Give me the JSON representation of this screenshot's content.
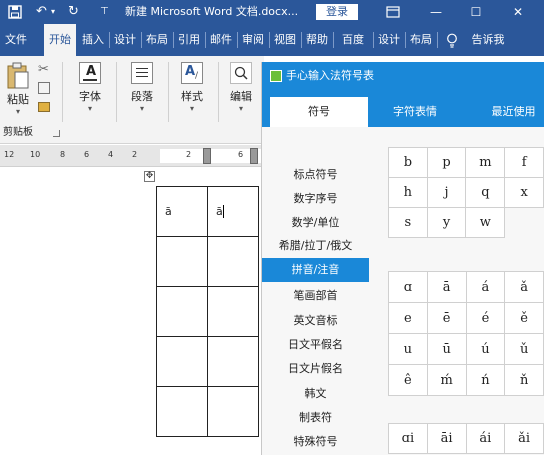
{
  "titlebar": {
    "save_icon": "save-icon",
    "undo_glyph": "↶",
    "redo_glyph": "↻",
    "customize_glyph": "⊤",
    "title": "新建 Microsoft Word 文档.docx...",
    "login": "登录",
    "ribbon_display_icon": "ribbon-display-icon",
    "window_buttons": [
      "—",
      "☐",
      "✕"
    ]
  },
  "ribbon_tabs": [
    "文件",
    "开始",
    "插入",
    "设计",
    "布局",
    "引用",
    "邮件",
    "审阅",
    "视图",
    "帮助",
    "百度",
    "设计",
    "布局"
  ],
  "tell_me": "告诉我",
  "ribbon": {
    "paste": "粘贴",
    "font": "字体",
    "paragraph": "段落",
    "styles": "样式",
    "editing": "编辑",
    "clipboard_group": "剪贴板"
  },
  "ruler": {
    "numbers": [
      "12",
      "10",
      "8",
      "6",
      "4",
      "2",
      "2",
      "6"
    ]
  },
  "document": {
    "cells": [
      [
        "ā",
        "ā"
      ],
      [
        "",
        ""
      ],
      [
        "",
        ""
      ],
      [
        "",
        ""
      ],
      [
        "",
        ""
      ]
    ]
  },
  "panel": {
    "title": "手心输入法符号表",
    "tabs": [
      "符号",
      "字符表情",
      "最近使用"
    ],
    "active_tab": 0,
    "categories": [
      "标点符号",
      "数字序号",
      "数学/单位",
      "希腊/拉丁/俄文",
      "拼音/注音",
      "笔画部首",
      "英文音标",
      "日文平假名",
      "日文片假名",
      "韩文",
      "制表符",
      "特殊符号"
    ],
    "active_category": 4,
    "grid_letters": [
      [
        "b",
        "p",
        "m",
        "f"
      ],
      [
        "h",
        "j",
        "q",
        "x"
      ],
      [
        "s",
        "y",
        "w",
        ""
      ]
    ],
    "grid_pinyin": [
      [
        "ɑ",
        "ā",
        "á",
        "ǎ"
      ],
      [
        "e",
        "ē",
        "é",
        "ě"
      ],
      [
        "u",
        "ū",
        "ú",
        "ǔ"
      ],
      [
        "ê",
        "ḿ",
        "ń",
        "ň"
      ]
    ],
    "grid_diphthong": [
      [
        "ɑi",
        "āi",
        "ái",
        "ǎi"
      ]
    ]
  }
}
